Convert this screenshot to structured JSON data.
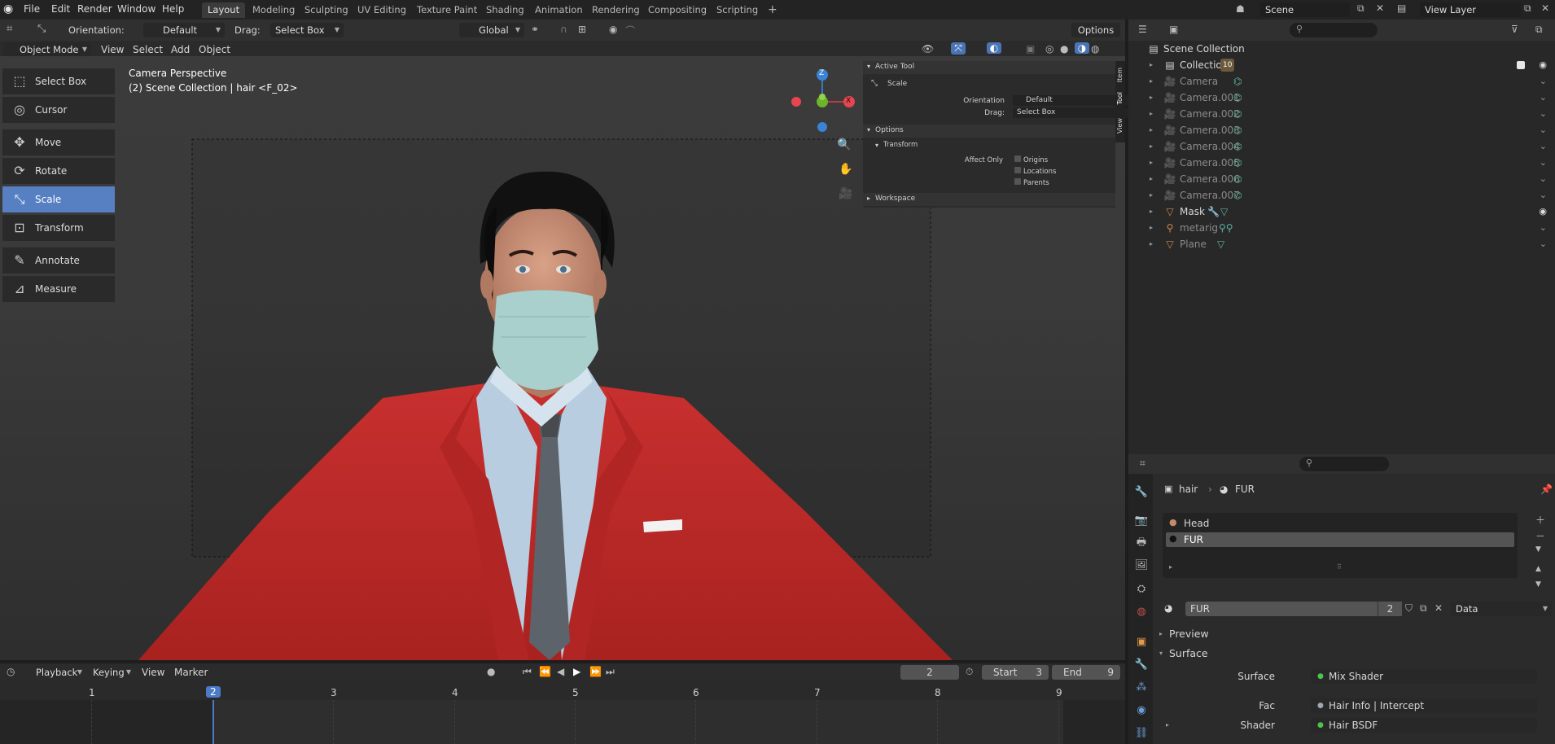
{
  "app": {
    "menus": [
      "File",
      "Edit",
      "Render",
      "Window",
      "Help"
    ],
    "workspaces": [
      "Layout",
      "Modeling",
      "Sculpting",
      "UV Editing",
      "Texture Paint",
      "Shading",
      "Animation",
      "Rendering",
      "Compositing",
      "Scripting"
    ],
    "active_workspace": "Layout",
    "add_workspace": "+",
    "scene": "Scene",
    "view_layer": "View Layer"
  },
  "tool_header": {
    "orientation_label": "Orientation:",
    "orientation_value": "Default",
    "drag_label": "Drag:",
    "drag_value": "Select Box",
    "transform_orientation": "Global",
    "options": "Options"
  },
  "viewport_header": {
    "mode": "Object Mode",
    "menus": [
      "View",
      "Select",
      "Add",
      "Object"
    ]
  },
  "toolbar": {
    "tools": [
      {
        "label": "Select Box",
        "icon": "select-box-icon",
        "glyph": "⬚"
      },
      {
        "label": "Cursor",
        "icon": "cursor-icon",
        "glyph": "◎"
      },
      {
        "label": "Move",
        "icon": "move-icon",
        "glyph": "✥"
      },
      {
        "label": "Rotate",
        "icon": "rotate-icon",
        "glyph": "⟳"
      },
      {
        "label": "Scale",
        "icon": "scale-icon",
        "glyph": "⤡"
      },
      {
        "label": "Transform",
        "icon": "transform-icon",
        "glyph": "⊡"
      },
      {
        "label": "Annotate",
        "icon": "annotate-icon",
        "glyph": "✎"
      },
      {
        "label": "Measure",
        "icon": "measure-icon",
        "glyph": "📐"
      }
    ],
    "selected": "Scale"
  },
  "viewport": {
    "overlay_line1": "Camera Perspective",
    "overlay_line2": "(2) Scene Collection | hair <F_02>",
    "gizmo": {
      "z": "Z",
      "x": "X"
    }
  },
  "sidebar": {
    "active_tool_title": "Active Tool",
    "tool_name": "Scale",
    "orientation_label": "Orientation",
    "orientation_value": "Default",
    "drag_label": "Drag:",
    "drag_value": "Select Box",
    "options_title": "Options",
    "transform_title": "Transform",
    "affect_only_label": "Affect Only",
    "affect_only": [
      "Origins",
      "Locations",
      "Parents"
    ],
    "workspace_title": "Workspace",
    "tabs": [
      "Item",
      "Tool",
      "View"
    ]
  },
  "outliner": {
    "root": "Scene Collection",
    "rows": [
      {
        "name": "Collection",
        "type": "collection",
        "badge": "10",
        "visible": true,
        "checked": true
      },
      {
        "name": "Camera",
        "type": "camera",
        "dim": true
      },
      {
        "name": "Camera.001",
        "type": "camera",
        "dim": true
      },
      {
        "name": "Camera.002",
        "type": "camera",
        "dim": true
      },
      {
        "name": "Camera.003",
        "type": "camera",
        "dim": true
      },
      {
        "name": "Camera.004",
        "type": "camera",
        "dim": true
      },
      {
        "name": "Camera.005",
        "type": "camera",
        "dim": true
      },
      {
        "name": "Camera.006",
        "type": "camera",
        "dim": true
      },
      {
        "name": "Camera.007",
        "type": "camera",
        "dim": true
      },
      {
        "name": "Mask",
        "type": "mesh",
        "dim": false,
        "visible": true
      },
      {
        "name": "metarig",
        "type": "armature",
        "dim": true
      },
      {
        "name": "Plane",
        "type": "mesh",
        "dim": true
      }
    ]
  },
  "properties": {
    "breadcrumb_object": "hair",
    "breadcrumb_material": "FUR",
    "material_slots": [
      "Head",
      "FUR"
    ],
    "selected_slot": "FUR",
    "material_name": "FUR",
    "users": "2",
    "link": "Data",
    "preview": "Preview",
    "surface_section": "Surface",
    "fields": [
      {
        "label": "Surface",
        "value": "Mix Shader"
      },
      {
        "label": "Fac",
        "value": "Hair Info | Intercept"
      },
      {
        "label": "Shader",
        "value": "Hair BSDF"
      }
    ]
  },
  "timeline": {
    "menus": [
      "Playback",
      "Keying",
      "View",
      "Marker"
    ],
    "current_frame": "2",
    "start_label": "Start",
    "start": "3",
    "end_label": "End",
    "end": "9",
    "ticks": [
      "1",
      "2",
      "3",
      "4",
      "5",
      "6",
      "7",
      "8",
      "9"
    ]
  }
}
